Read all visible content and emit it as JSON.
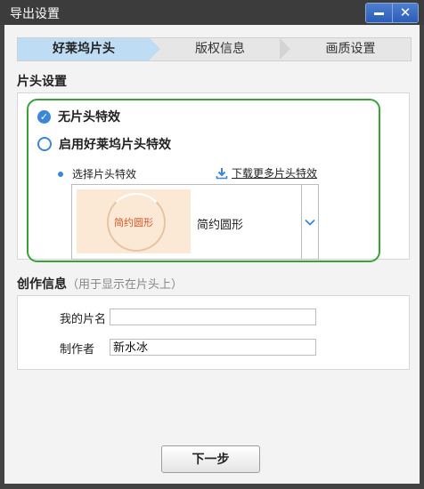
{
  "window": {
    "title": "导出设置",
    "minimize_icon": "minimize-icon",
    "close_icon": "close-icon",
    "accent_color": "#2b5db8"
  },
  "steps": [
    {
      "label": "好莱坞片头",
      "active": true
    },
    {
      "label": "版权信息",
      "active": false
    },
    {
      "label": "画质设置",
      "active": false
    }
  ],
  "intro_section": {
    "title": "片头设置",
    "options": [
      {
        "label": "无片头特效",
        "checked": true
      },
      {
        "label": "启用好莱坞片头特效",
        "checked": false
      }
    ],
    "choose_label": "选择片头特效",
    "download_link": "下载更多片头特效",
    "effect": {
      "thumbnail_text": "简约圆形",
      "name": "简约圆形"
    },
    "highlight_color": "#3aa13a"
  },
  "credits_section": {
    "title": "创作信息",
    "hint": "（用于显示在片头上）",
    "fields": [
      {
        "label": "我的片名",
        "value": ""
      },
      {
        "label": "制作者",
        "value": "新水冰"
      }
    ]
  },
  "footer": {
    "next_label": "下一步"
  }
}
